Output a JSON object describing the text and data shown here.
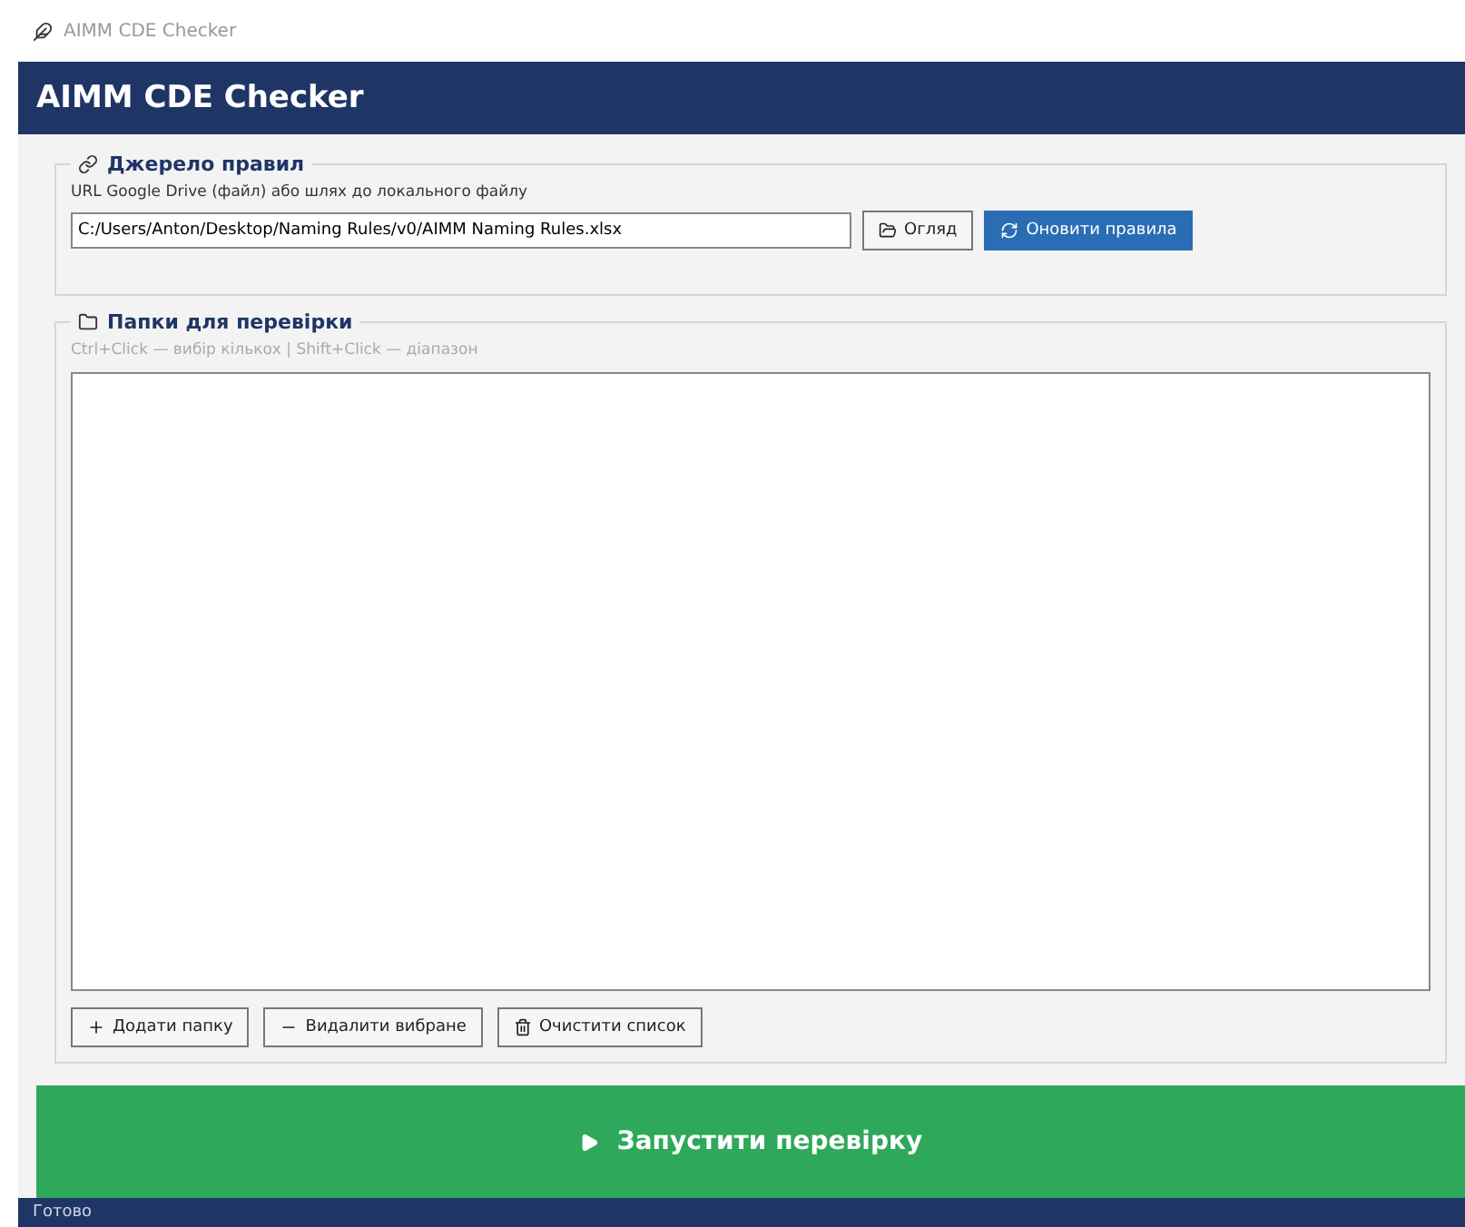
{
  "window": {
    "title": "AIMM CDE Checker"
  },
  "header": {
    "title": "AIMM CDE Checker"
  },
  "rules_section": {
    "title": "Джерело правил",
    "hint": "URL Google Drive (файл) або шлях до локального файлу",
    "path": "C:/Users/Anton/Desktop/Naming Rules/v0/AIMM Naming Rules.xlsx",
    "browse_button": "Огляд",
    "update_button": "Оновити правила"
  },
  "folders_section": {
    "title": "Папки для перевірки",
    "hint": "Ctrl+Click — вибір кількох | Shift+Click — діапазон",
    "buttons": [
      {
        "kind": "add",
        "label": "Додати папку"
      },
      {
        "kind": "remove",
        "label": "Видалити вибране"
      },
      {
        "kind": "clear",
        "label": "Очистити список"
      }
    ]
  },
  "run_button": {
    "label": "Запустити перевірку"
  },
  "status_bar": {
    "text": "Готово"
  }
}
